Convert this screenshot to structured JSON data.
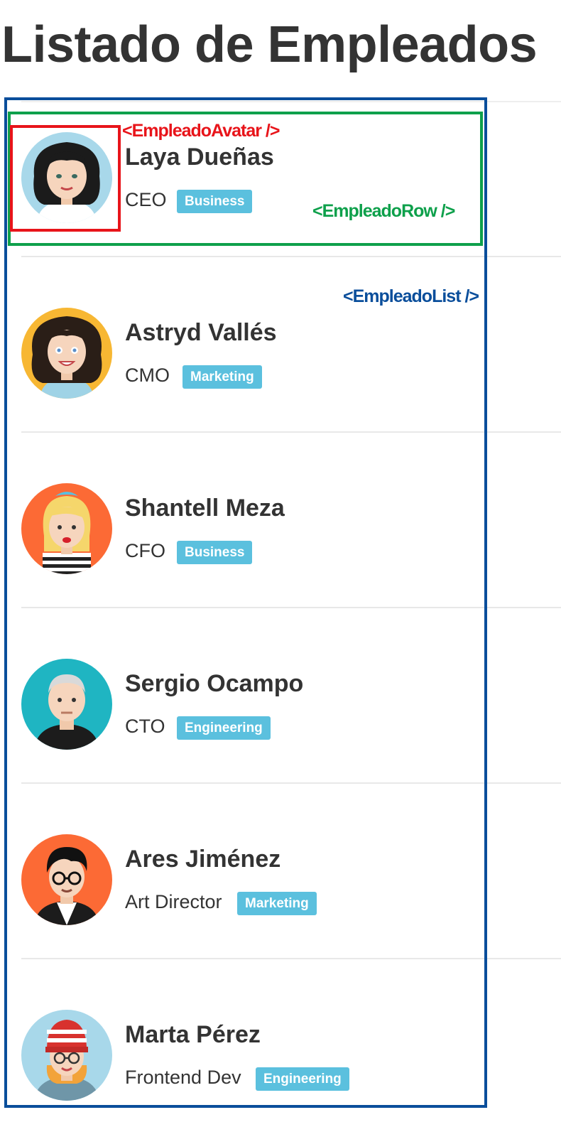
{
  "page": {
    "title": "Listado de Empleados"
  },
  "annotations": {
    "avatar_tag": "<EmpleadoAvatar />",
    "row_tag": "<EmpleadoRow />",
    "list_tag": "<EmpleadoList />",
    "colors": {
      "avatar": "#e8141a",
      "row": "#0ea04b",
      "list": "#0a4e9b"
    }
  },
  "badge_color": "#5bc0de",
  "employees": [
    {
      "name": "Laya Dueñas",
      "role": "CEO",
      "department": "Business",
      "avatar_icon": "woman-dark-hair-avatar-icon",
      "avatar_bg": "#a8d8ea"
    },
    {
      "name": "Astryd Vallés",
      "role": "CMO",
      "department": "Marketing",
      "avatar_icon": "woman-curly-hair-avatar-icon",
      "avatar_bg": "#f7b733"
    },
    {
      "name": "Shantell Meza",
      "role": "CFO",
      "department": "Business",
      "avatar_icon": "woman-blonde-avatar-icon",
      "avatar_bg": "#fc6a35"
    },
    {
      "name": "Sergio Ocampo",
      "role": "CTO",
      "department": "Engineering",
      "avatar_icon": "man-grey-hair-avatar-icon",
      "avatar_bg": "#1fb5c2"
    },
    {
      "name": "Ares Jiménez",
      "role": "Art Director",
      "department": "Marketing",
      "avatar_icon": "man-glasses-avatar-icon",
      "avatar_bg": "#fc6a35"
    },
    {
      "name": "Marta Pérez",
      "role": "Frontend Dev",
      "department": "Engineering",
      "avatar_icon": "woman-beanie-avatar-icon",
      "avatar_bg": "#a8d8ea"
    }
  ]
}
